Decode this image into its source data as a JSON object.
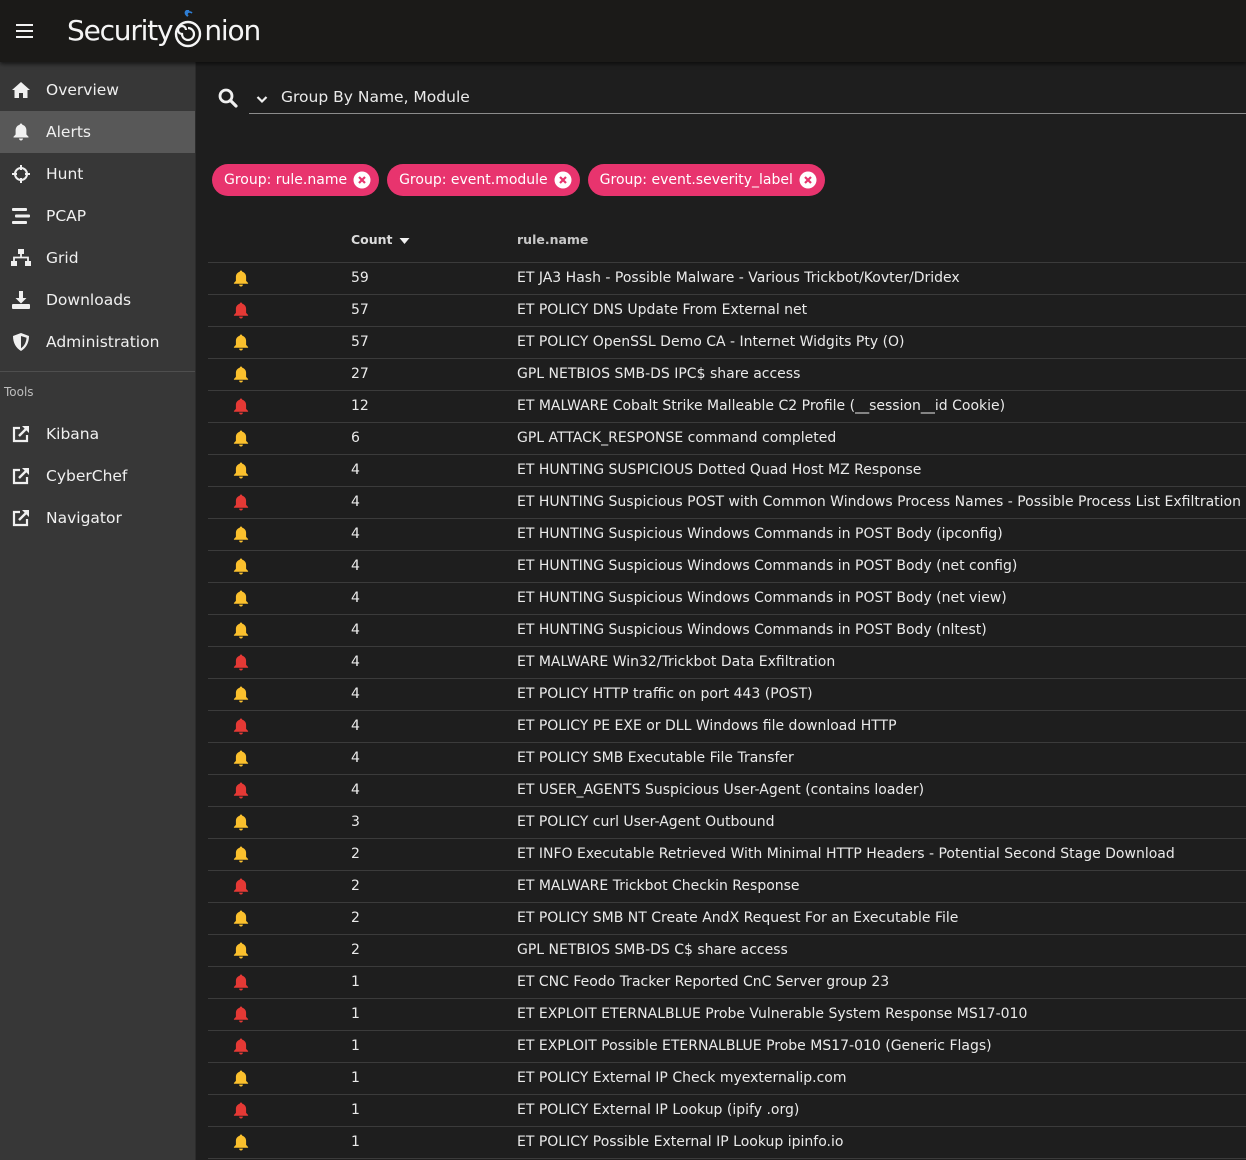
{
  "app": {
    "logo_text_left": "Security",
    "logo_text_right": "nion"
  },
  "sidebar": {
    "items": [
      {
        "label": "Overview",
        "icon": "home-icon",
        "active": false
      },
      {
        "label": "Alerts",
        "icon": "bell-icon",
        "active": true
      },
      {
        "label": "Hunt",
        "icon": "crosshairs-icon",
        "active": false
      },
      {
        "label": "PCAP",
        "icon": "stream-icon",
        "active": false
      },
      {
        "label": "Grid",
        "icon": "network-icon",
        "active": false
      },
      {
        "label": "Downloads",
        "icon": "download-icon",
        "active": false
      },
      {
        "label": "Administration",
        "icon": "shield-icon",
        "active": false
      }
    ],
    "tools_heading": "Tools",
    "tools": [
      {
        "label": "Kibana",
        "icon": "external-link-icon"
      },
      {
        "label": "CyberChef",
        "icon": "external-link-icon"
      },
      {
        "label": "Navigator",
        "icon": "external-link-icon"
      }
    ]
  },
  "search": {
    "value": "Group By Name, Module"
  },
  "chips": [
    {
      "label": "Group: rule.name"
    },
    {
      "label": "Group: event.module"
    },
    {
      "label": "Group: event.severity_label"
    }
  ],
  "table": {
    "headers": {
      "count": "Count",
      "rule": "rule.name"
    },
    "colors": {
      "high": "#e53935",
      "medium": "#fbc02d"
    },
    "rows": [
      {
        "severity": "medium",
        "count": "59",
        "rule": "ET JA3 Hash - Possible Malware - Various Trickbot/Kovter/Dridex"
      },
      {
        "severity": "high",
        "count": "57",
        "rule": "ET POLICY DNS Update From External net"
      },
      {
        "severity": "medium",
        "count": "57",
        "rule": "ET POLICY OpenSSL Demo CA - Internet Widgits Pty (O)"
      },
      {
        "severity": "medium",
        "count": "27",
        "rule": "GPL NETBIOS SMB-DS IPC$ share access"
      },
      {
        "severity": "high",
        "count": "12",
        "rule": "ET MALWARE Cobalt Strike Malleable C2 Profile (__session__id Cookie)"
      },
      {
        "severity": "medium",
        "count": "6",
        "rule": "GPL ATTACK_RESPONSE command completed"
      },
      {
        "severity": "medium",
        "count": "4",
        "rule": "ET HUNTING SUSPICIOUS Dotted Quad Host MZ Response"
      },
      {
        "severity": "high",
        "count": "4",
        "rule": "ET HUNTING Suspicious POST with Common Windows Process Names - Possible Process List Exfiltration"
      },
      {
        "severity": "medium",
        "count": "4",
        "rule": "ET HUNTING Suspicious Windows Commands in POST Body (ipconfig)"
      },
      {
        "severity": "medium",
        "count": "4",
        "rule": "ET HUNTING Suspicious Windows Commands in POST Body (net config)"
      },
      {
        "severity": "medium",
        "count": "4",
        "rule": "ET HUNTING Suspicious Windows Commands in POST Body (net view)"
      },
      {
        "severity": "medium",
        "count": "4",
        "rule": "ET HUNTING Suspicious Windows Commands in POST Body (nltest)"
      },
      {
        "severity": "high",
        "count": "4",
        "rule": "ET MALWARE Win32/Trickbot Data Exfiltration"
      },
      {
        "severity": "medium",
        "count": "4",
        "rule": "ET POLICY HTTP traffic on port 443 (POST)"
      },
      {
        "severity": "high",
        "count": "4",
        "rule": "ET POLICY PE EXE or DLL Windows file download HTTP"
      },
      {
        "severity": "medium",
        "count": "4",
        "rule": "ET POLICY SMB Executable File Transfer"
      },
      {
        "severity": "high",
        "count": "4",
        "rule": "ET USER_AGENTS Suspicious User-Agent (contains loader)"
      },
      {
        "severity": "medium",
        "count": "3",
        "rule": "ET POLICY curl User-Agent Outbound"
      },
      {
        "severity": "medium",
        "count": "2",
        "rule": "ET INFO Executable Retrieved With Minimal HTTP Headers - Potential Second Stage Download"
      },
      {
        "severity": "high",
        "count": "2",
        "rule": "ET MALWARE Trickbot Checkin Response"
      },
      {
        "severity": "medium",
        "count": "2",
        "rule": "ET POLICY SMB NT Create AndX Request For an Executable File"
      },
      {
        "severity": "medium",
        "count": "2",
        "rule": "GPL NETBIOS SMB-DS C$ share access"
      },
      {
        "severity": "high",
        "count": "1",
        "rule": "ET CNC Feodo Tracker Reported CnC Server group 23"
      },
      {
        "severity": "high",
        "count": "1",
        "rule": "ET EXPLOIT ETERNALBLUE Probe Vulnerable System Response MS17-010"
      },
      {
        "severity": "high",
        "count": "1",
        "rule": "ET EXPLOIT Possible ETERNALBLUE Probe MS17-010 (Generic Flags)"
      },
      {
        "severity": "medium",
        "count": "1",
        "rule": "ET POLICY External IP Check myexternalip.com"
      },
      {
        "severity": "high",
        "count": "1",
        "rule": "ET POLICY External IP Lookup (ipify .org)"
      },
      {
        "severity": "medium",
        "count": "1",
        "rule": "ET POLICY Possible External IP Lookup ipinfo.io"
      }
    ]
  }
}
